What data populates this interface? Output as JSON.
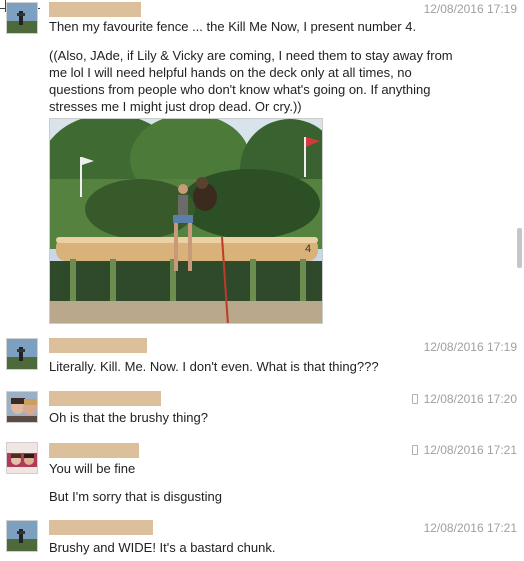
{
  "messages": [
    {
      "timestamp": "12/08/2016 17:19",
      "lines": [
        "Then my favourite fence ... the Kill Me Now, I present number 4.",
        "((Also, JAde, if Lily & Vicky are coming, I need them to stay away from",
        "me lol I will need helpful hands on the deck only at all times, no",
        "questions from people who don't know what's going on. If anything",
        "stresses me I might just drop dead. Or cry.))"
      ],
      "has_photo": true
    },
    {
      "timestamp": "12/08/2016 17:19",
      "text": "Literally. Kill. Me. Now. I don't even. What is that thing???"
    },
    {
      "timestamp": "12/08/2016 17:20",
      "text": "Oh is that the brushy thing?",
      "mobile": true
    },
    {
      "timestamp": "12/08/2016 17:21",
      "lines": [
        "You will be fine",
        "But I'm sorry that is disgusting"
      ],
      "mobile": true
    },
    {
      "timestamp": "12/08/2016 17:21",
      "text": "Brushy and WIDE! It's a bastard chunk."
    }
  ],
  "photo": {
    "fence_number": "4"
  },
  "colors": {
    "redaction": "#dcc09c",
    "timestamp": "#a0a0a0",
    "text": "#222222"
  }
}
